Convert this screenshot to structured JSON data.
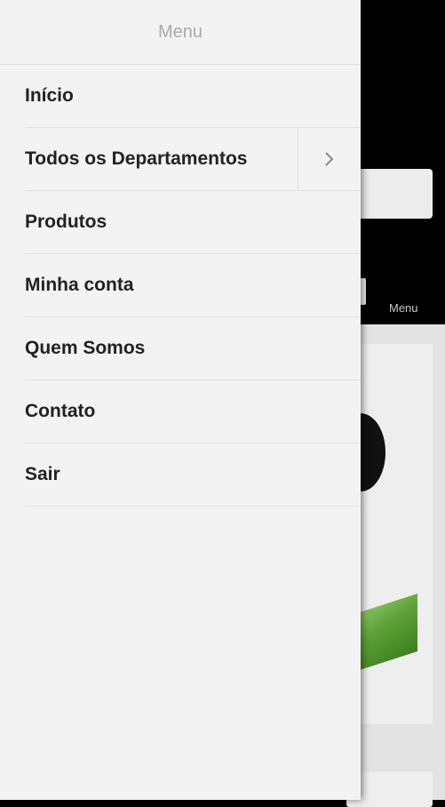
{
  "drawer": {
    "title": "Menu",
    "items": [
      {
        "label": "Início"
      },
      {
        "label": "Todos os Departamentos",
        "icon": "chevron-right-icon"
      },
      {
        "label": "Produtos"
      },
      {
        "label": "Minha conta"
      },
      {
        "label": "Quem Somos"
      },
      {
        "label": "Contato"
      },
      {
        "label": "Sair"
      }
    ]
  },
  "background_page": {
    "menu_label": "Menu"
  },
  "colors": {
    "drawer_bg": "#f3f3f3",
    "page_bg": "#000000",
    "text": "#222222",
    "title": "#aaaaaa"
  }
}
